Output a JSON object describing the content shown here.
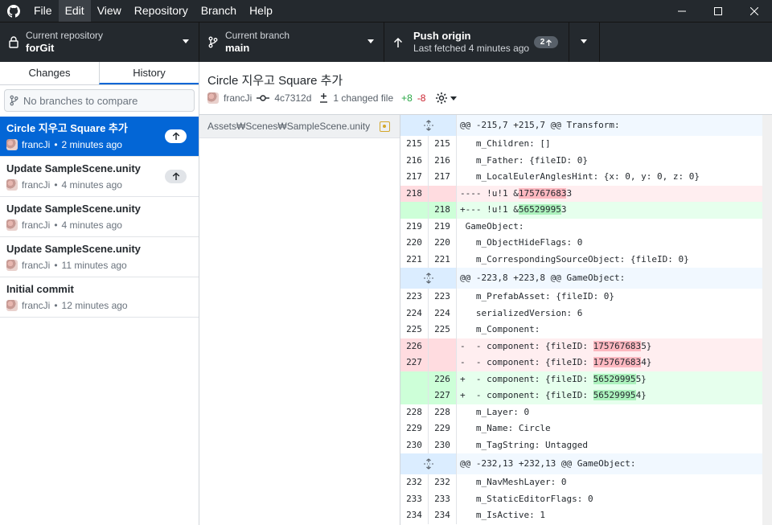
{
  "menu": [
    "File",
    "Edit",
    "View",
    "Repository",
    "Branch",
    "Help"
  ],
  "toolbar": {
    "repo_label": "Current repository",
    "repo_name": "forGit",
    "branch_label": "Current branch",
    "branch_name": "main",
    "push_label": "Push origin",
    "push_sub": "Last fetched 4 minutes ago",
    "push_count": "2"
  },
  "sidebar": {
    "tab_changes": "Changes",
    "tab_history": "History",
    "branch_placeholder": "No branches to compare",
    "commits": [
      {
        "title": "Circle 지우고 Square 추가",
        "author": "francJi",
        "time": "2 minutes ago",
        "unpushed": true
      },
      {
        "title": "Update SampleScene.unity",
        "author": "francJi",
        "time": "4 minutes ago",
        "unpushed": true
      },
      {
        "title": "Update SampleScene.unity",
        "author": "francJi",
        "time": "4 minutes ago",
        "unpushed": false
      },
      {
        "title": "Update SampleScene.unity",
        "author": "francJi",
        "time": "11 minutes ago",
        "unpushed": false
      },
      {
        "title": "Initial commit",
        "author": "francJi",
        "time": "12 minutes ago",
        "unpushed": false
      }
    ]
  },
  "commit": {
    "title": "Circle 지우고 Square 추가",
    "author": "francJi",
    "sha": "4c7312d",
    "files_changed": "1 changed file",
    "additions": "+8",
    "deletions": "-8"
  },
  "files": [
    {
      "path": "Assets₩Scenes₩SampleScene.unity",
      "status": "modified"
    }
  ],
  "diff": [
    {
      "type": "hunk",
      "text": "@@ -215,7 +215,7 @@ Transform:"
    },
    {
      "type": "ctx",
      "old": "215",
      "new": "215",
      "text": "  m_Children: []"
    },
    {
      "type": "ctx",
      "old": "216",
      "new": "216",
      "text": "  m_Father: {fileID: 0}"
    },
    {
      "type": "ctx",
      "old": "217",
      "new": "217",
      "text": "  m_LocalEulerAnglesHint: {x: 0, y: 0, z: 0}"
    },
    {
      "type": "del",
      "old": "218",
      "new": "",
      "pre": "---- !u!1 &",
      "hl": "175767683",
      "post": "3"
    },
    {
      "type": "add",
      "old": "",
      "new": "218",
      "pre": "+--- !u!1 &",
      "hl": "56529995",
      "post": "3"
    },
    {
      "type": "ctx",
      "old": "219",
      "new": "219",
      "text": "GameObject:"
    },
    {
      "type": "ctx",
      "old": "220",
      "new": "220",
      "text": "  m_ObjectHideFlags: 0"
    },
    {
      "type": "ctx",
      "old": "221",
      "new": "221",
      "text": "  m_CorrespondingSourceObject: {fileID: 0}"
    },
    {
      "type": "hunk",
      "text": "@@ -223,8 +223,8 @@ GameObject:"
    },
    {
      "type": "ctx",
      "old": "223",
      "new": "223",
      "text": "  m_PrefabAsset: {fileID: 0}"
    },
    {
      "type": "ctx",
      "old": "224",
      "new": "224",
      "text": "  serializedVersion: 6"
    },
    {
      "type": "ctx",
      "old": "225",
      "new": "225",
      "text": "  m_Component:"
    },
    {
      "type": "del",
      "old": "226",
      "new": "",
      "pre": "-  - component: {fileID: ",
      "hl": "175767683",
      "post": "5}"
    },
    {
      "type": "del",
      "old": "227",
      "new": "",
      "pre": "-  - component: {fileID: ",
      "hl": "175767683",
      "post": "4}"
    },
    {
      "type": "add",
      "old": "",
      "new": "226",
      "pre": "+  - component: {fileID: ",
      "hl": "56529995",
      "post": "5}"
    },
    {
      "type": "add",
      "old": "",
      "new": "227",
      "pre": "+  - component: {fileID: ",
      "hl": "56529995",
      "post": "4}"
    },
    {
      "type": "ctx",
      "old": "228",
      "new": "228",
      "text": "  m_Layer: 0"
    },
    {
      "type": "ctx",
      "old": "229",
      "new": "229",
      "text": "  m_Name: Circle"
    },
    {
      "type": "ctx",
      "old": "230",
      "new": "230",
      "text": "  m_TagString: Untagged"
    },
    {
      "type": "hunk",
      "text": "@@ -232,13 +232,13 @@ GameObject:"
    },
    {
      "type": "ctx",
      "old": "232",
      "new": "232",
      "text": "  m_NavMeshLayer: 0"
    },
    {
      "type": "ctx",
      "old": "233",
      "new": "233",
      "text": "  m_StaticEditorFlags: 0"
    },
    {
      "type": "ctx",
      "old": "234",
      "new": "234",
      "text": "  m_IsActive: 1"
    }
  ]
}
